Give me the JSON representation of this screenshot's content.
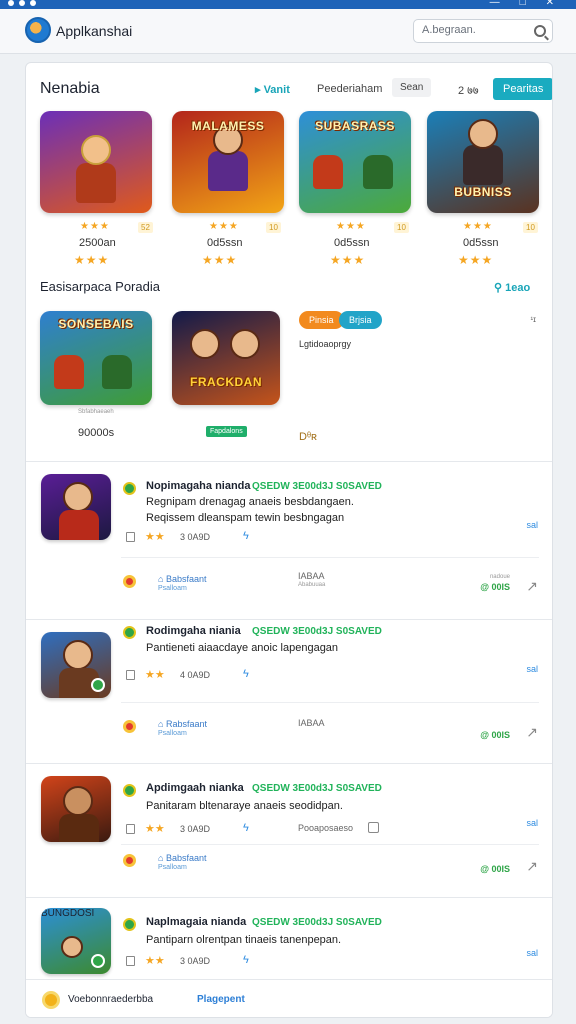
{
  "app": {
    "name": "Applkanshai",
    "search_placeholder": "A.begraan."
  },
  "window_controls": [
    "—",
    "□",
    "✕"
  ],
  "featured": {
    "title": "Nenabia",
    "link": "Vanit",
    "sort_label": "Peederiaham",
    "chip": "Sean",
    "count": "2 ७७",
    "cta": "Pearitas",
    "items": [
      {
        "name": "2500an",
        "tile_text": "",
        "tag": "52",
        "stars_top": "★★★",
        "stars_bottom": "★★★",
        "colors": [
          "#6b2fb8",
          "#e05a1a"
        ]
      },
      {
        "name": "0d5ssn",
        "tile_text": "MALAMESS",
        "tag": "10",
        "stars_top": "★★★",
        "stars_bottom": "★★★",
        "colors": [
          "#b3251b",
          "#f2a516"
        ]
      },
      {
        "name": "0d5ssn",
        "tile_text": "SUBASRASS",
        "tag": "10",
        "stars_top": "★★★",
        "stars_bottom": "★★★",
        "colors": [
          "#2e8fd8",
          "#4caa3a"
        ]
      },
      {
        "name": "0d5ssn",
        "tile_text": "BUBNISS",
        "tag": "10",
        "stars_top": "★★★",
        "stars_bottom": "★★★",
        "colors": [
          "#1b7fb8",
          "#5a3220"
        ]
      }
    ]
  },
  "section2": {
    "title": "Easisarpaca Poradia",
    "link": "1eao",
    "close": "¹ɪ",
    "items": [
      {
        "name": "90000s",
        "caption": "Sbfabhaeaeh",
        "tile_text": "SONSEBAIS",
        "colors": [
          "#2f7fd0",
          "#3f9d35"
        ]
      },
      {
        "name": "",
        "caption": "",
        "badge": "Fapdalons",
        "tile_text": "FRACKDAN",
        "colors": [
          "#121a4a",
          "#c5541a"
        ]
      }
    ],
    "pills": [
      {
        "label": "Pinsia",
        "color": "#f28a1e"
      },
      {
        "label": "Brjsia",
        "color": "#22a4c8"
      }
    ],
    "text": "Lgtidoaoprgy",
    "extra": "Dᶿʀ"
  },
  "list": [
    {
      "title": "Nopimagaha nianda",
      "green": "QSEDW 3E00d3J  S0SAVED",
      "desc1": "Regnipam drenagag anaeis besbdangaen.",
      "desc2": "Reqissem dleanspam tewin besbngagan",
      "rating_stars": "★★",
      "meta": "3 0A9D",
      "side": "sal",
      "dev": "Babsfaant",
      "dev_sub": "Psalloam",
      "count": "IABAA",
      "count_sub": "Ababuuaa",
      "green_r": "@ 00IS",
      "green_r_sub": "nadoue",
      "colors": [
        "#5a1e96",
        "#1c1840"
      ]
    },
    {
      "title": "Rodimgaha niania",
      "green": "QSEDW 3E00d3J  S0SAVED",
      "desc1": "Pantieneti aiaacdaye anoic lapengagan",
      "desc2": "",
      "rating_stars": "★★",
      "meta": "4 0A9D",
      "side": "sal",
      "dev": "Rabsfaant",
      "dev_sub": "Psalloam",
      "count": "IABAA",
      "count_sub": "",
      "green_r": "@ 00IS",
      "green_r_sub": "",
      "colors": [
        "#2f6fc0",
        "#6a3a20"
      ]
    },
    {
      "title": "Apdimgaah nianka",
      "green": "QSEDW 3E00d3J  S0SAVED",
      "desc1": "Panitaram bltenaraye anaeis seodidpan.",
      "desc2": "",
      "rating_stars": "★★",
      "meta": "3 0A9D",
      "side": "sal",
      "dev": "Babsfaant",
      "dev_sub": "Psalloam",
      "count": "Pooaposaeso",
      "count_sub": "",
      "green_r": "@ 00IS",
      "green_r_sub": "",
      "colors": [
        "#d2441a",
        "#3a1a10"
      ]
    },
    {
      "title": "Naplmagaia nianda",
      "green": "QSEDW 3E00d3J  S0SAVED",
      "desc1": "Pantiparn olrentpan tinaeis tanenpepan.",
      "desc2": "",
      "rating_stars": "★★",
      "meta": "3 0A9D",
      "side": "sal",
      "dev": "",
      "dev_sub": "",
      "count": "",
      "count_sub": "",
      "green_r": "",
      "green_r_sub": "",
      "tile_text": "BUNGDOSI",
      "colors": [
        "#2c8fd6",
        "#3d8a2e"
      ]
    }
  ],
  "footer": {
    "text": "Voebonnraederbba",
    "link": "Plagepent"
  }
}
